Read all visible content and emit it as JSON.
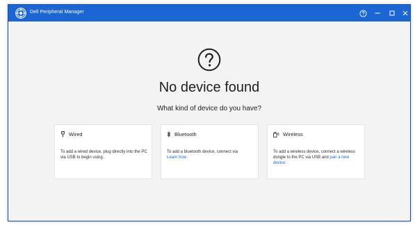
{
  "window": {
    "title": "Dell Peripheral Manager",
    "accent_color": "#1c66d4",
    "controls": {
      "help_icon": "question-circle-icon",
      "minimize_icon": "minimize-icon",
      "maximize_icon": "maximize-icon",
      "close_icon": "close-icon"
    }
  },
  "main": {
    "icon": "question-circle-icon",
    "heading": "No device found",
    "subheading": "What kind of device do you have?"
  },
  "cards": [
    {
      "icon": "usb-plug-icon",
      "title": "Wired",
      "description": "To add a wired device, plug directly into the PC via USB to begin using.",
      "link": ""
    },
    {
      "icon": "bluetooth-icon",
      "title": "Bluetooth",
      "description": "To add a bluetooth device, connect via",
      "link": "Learn how."
    },
    {
      "icon": "wireless-dongle-icon",
      "title": "Wireless",
      "description": "To add a wireless device, connect a wireless dongle to the PC via USB and",
      "link": "pair a new device."
    }
  ]
}
